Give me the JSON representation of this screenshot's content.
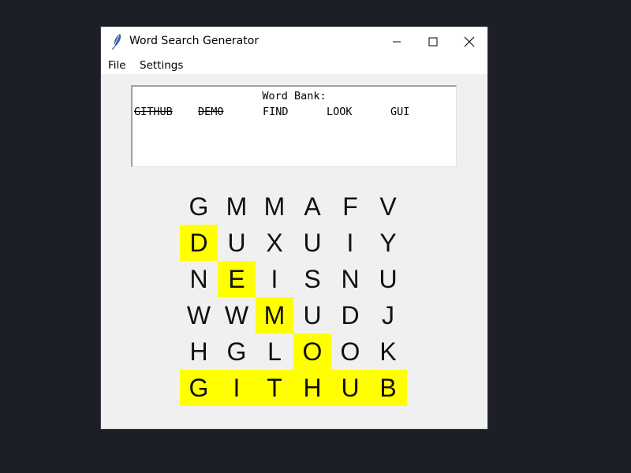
{
  "window": {
    "title": "Word Search Generator",
    "icon": "feather-icon"
  },
  "menu": [
    "File",
    "Settings"
  ],
  "word_bank": {
    "title": "Word Bank:",
    "words": [
      {
        "text": "GITHUB",
        "found": true
      },
      {
        "text": "DEMO",
        "found": true
      },
      {
        "text": "FIND",
        "found": false
      },
      {
        "text": "LOOK",
        "found": false
      },
      {
        "text": "GUI",
        "found": false
      }
    ]
  },
  "grid": {
    "rows": [
      [
        "G",
        "M",
        "M",
        "A",
        "F",
        "V"
      ],
      [
        "D",
        "U",
        "X",
        "U",
        "I",
        "Y"
      ],
      [
        "N",
        "E",
        "I",
        "S",
        "N",
        "U"
      ],
      [
        "W",
        "W",
        "M",
        "U",
        "D",
        "J"
      ],
      [
        "H",
        "G",
        "L",
        "O",
        "O",
        "K"
      ],
      [
        "G",
        "I",
        "T",
        "H",
        "U",
        "B"
      ]
    ],
    "highlight_color": "#ffff00",
    "highlighted": [
      [
        1,
        0
      ],
      [
        2,
        1
      ],
      [
        3,
        2
      ],
      [
        4,
        3
      ],
      [
        5,
        0
      ],
      [
        5,
        1
      ],
      [
        5,
        2
      ],
      [
        5,
        3
      ],
      [
        5,
        4
      ],
      [
        5,
        5
      ]
    ]
  }
}
